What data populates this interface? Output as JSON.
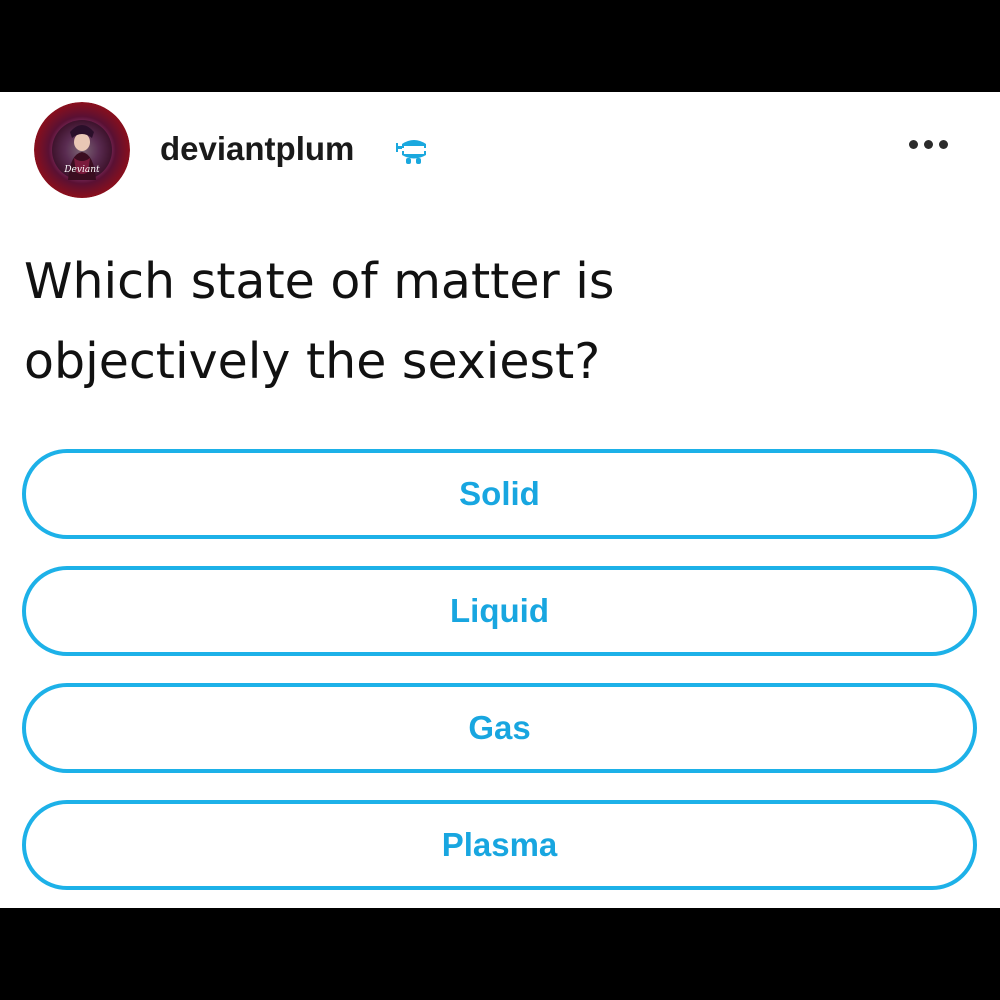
{
  "post": {
    "username": "deviantplum",
    "avatar_icon": "user-avatar-icon",
    "badge_icon": "wind-up-teeth-icon",
    "more_icon": "more-options-icon",
    "question_line1": "Which state of matter is",
    "question_line2": "objectively the sexiest?"
  },
  "poll": {
    "options": [
      {
        "label": "Solid"
      },
      {
        "label": "Liquid"
      },
      {
        "label": "Gas"
      },
      {
        "label": "Plasma"
      }
    ]
  },
  "colors": {
    "accent": "#1db1e8",
    "text": "#111111",
    "background": "#ffffff",
    "letterbox": "#000000"
  }
}
